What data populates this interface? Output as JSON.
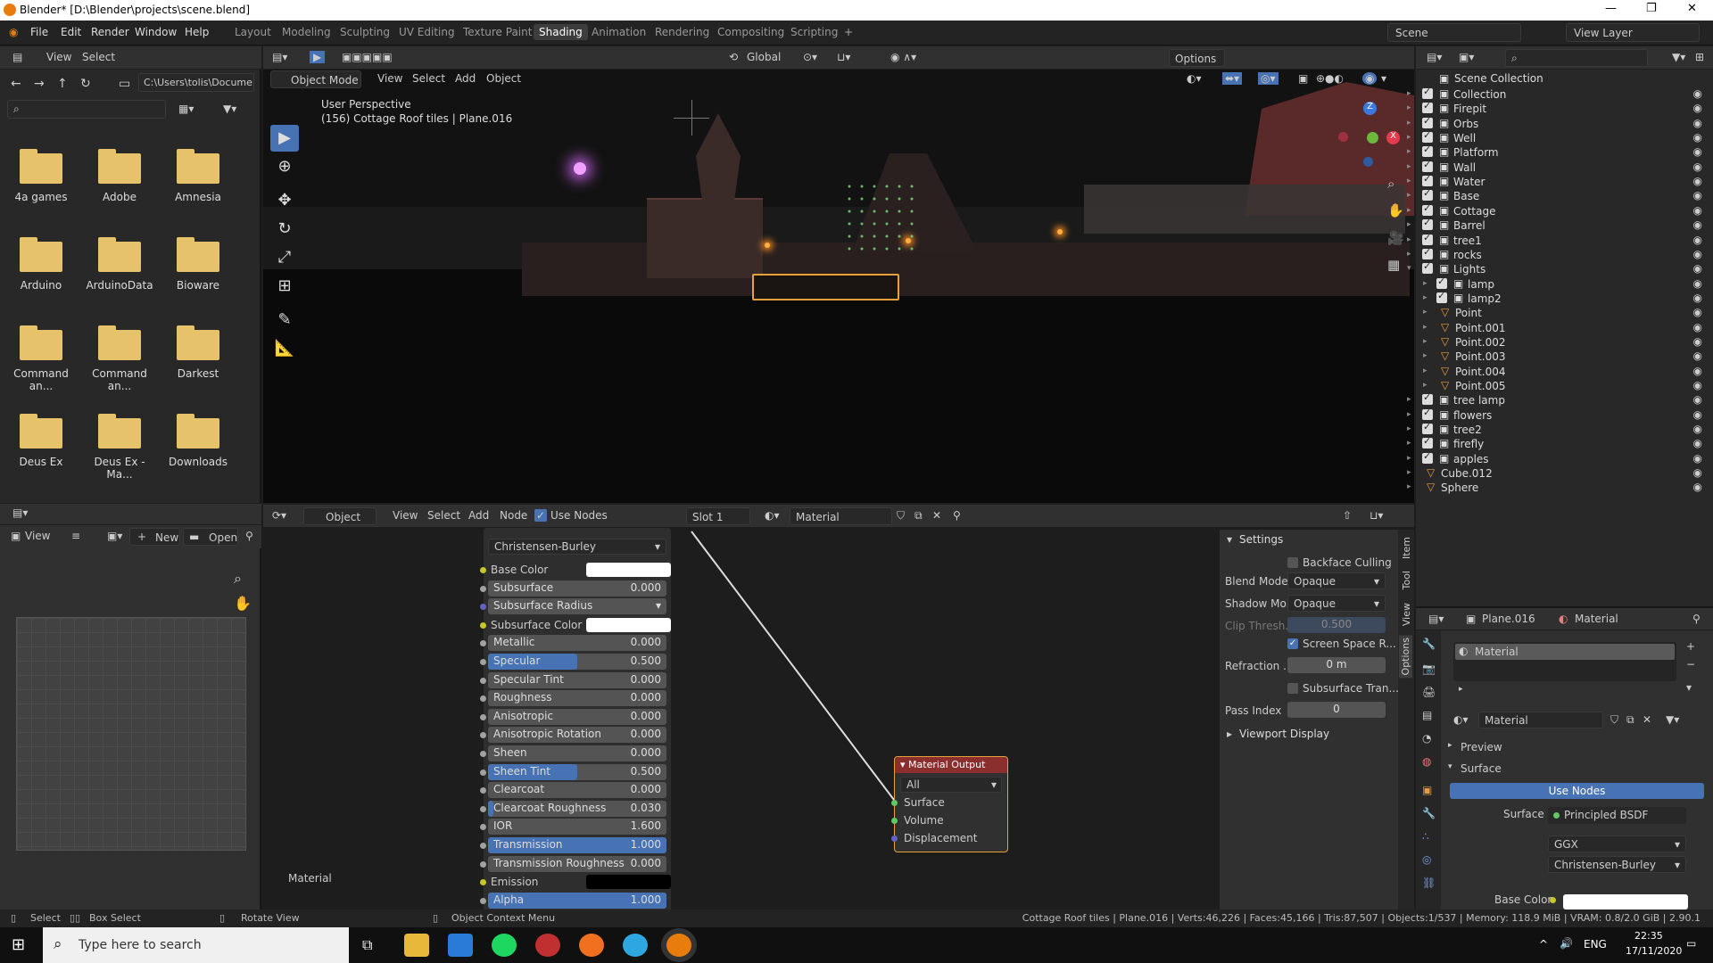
{
  "window": {
    "title": "Blender* [D:\\Blender\\projects\\scene.blend]",
    "min": "—",
    "max": "❐",
    "close": "✕"
  },
  "menu": [
    "File",
    "Edit",
    "Render",
    "Window",
    "Help"
  ],
  "workspaces": [
    "Layout",
    "Modeling",
    "Sculpting",
    "UV Editing",
    "Texture Paint",
    "Shading",
    "Animation",
    "Rendering",
    "Compositing",
    "Scripting"
  ],
  "active_workspace": "Shading",
  "scene": {
    "label": "Scene",
    "view_layer": "View Layer"
  },
  "file_browser": {
    "menus": [
      "View",
      "Select"
    ],
    "path": "C:\\Users\\tolis\\Docume...",
    "folders": [
      "4a games",
      "Adobe",
      "Amnesia",
      "Arduino",
      "ArduinoData",
      "Bioware",
      "Command an...",
      "Command an...",
      "Darkest",
      "Deus Ex",
      "Deus Ex - Ma...",
      "Downloads"
    ]
  },
  "image_editor": {
    "view": "View",
    "new": "New",
    "open": "Open"
  },
  "viewport": {
    "mode": "Object Mode",
    "menus": [
      "View",
      "Select",
      "Add",
      "Object"
    ],
    "transform": "Global",
    "options": "Options",
    "info1": "User Perspective",
    "info2": "(156) Cottage Roof tiles | Plane.016",
    "gizmo": {
      "z": "Z",
      "y": "Y",
      "x": "X"
    }
  },
  "node_editor": {
    "mode": "Object",
    "menus": [
      "View",
      "Select",
      "Add",
      "Node"
    ],
    "use_nodes": "Use Nodes",
    "slot": "Slot 1",
    "material": "Material",
    "label_bottom": "Material",
    "bsdf": {
      "distribution": "Christensen-Burley",
      "rows": [
        {
          "label": "Base Color",
          "type": "color",
          "color": "#ffffff",
          "socket": "#c7c729"
        },
        {
          "label": "Subsurface",
          "value": "0.000",
          "socket": "#a1a1a1"
        },
        {
          "label": "Subsurface Radius",
          "type": "select",
          "socket": "#6363c7"
        },
        {
          "label": "Subsurface Color",
          "type": "color",
          "color": "#ffffff",
          "socket": "#c7c729"
        },
        {
          "label": "Metallic",
          "value": "0.000",
          "socket": "#a1a1a1"
        },
        {
          "label": "Specular",
          "value": "0.500",
          "fill": 0.5,
          "socket": "#a1a1a1"
        },
        {
          "label": "Specular Tint",
          "value": "0.000",
          "socket": "#a1a1a1"
        },
        {
          "label": "Roughness",
          "value": "0.000",
          "socket": "#a1a1a1"
        },
        {
          "label": "Anisotropic",
          "value": "0.000",
          "socket": "#a1a1a1"
        },
        {
          "label": "Anisotropic Rotation",
          "value": "0.000",
          "socket": "#a1a1a1"
        },
        {
          "label": "Sheen",
          "value": "0.000",
          "socket": "#a1a1a1"
        },
        {
          "label": "Sheen Tint",
          "value": "0.500",
          "fill": 0.5,
          "socket": "#a1a1a1"
        },
        {
          "label": "Clearcoat",
          "value": "0.000",
          "socket": "#a1a1a1"
        },
        {
          "label": "Clearcoat Roughness",
          "value": "0.030",
          "fill": 0.03,
          "socket": "#a1a1a1"
        },
        {
          "label": "IOR",
          "value": "1.600",
          "socket": "#a1a1a1"
        },
        {
          "label": "Transmission",
          "value": "1.000",
          "fill": 1,
          "socket": "#a1a1a1"
        },
        {
          "label": "Transmission Roughness",
          "value": "0.000",
          "socket": "#a1a1a1"
        },
        {
          "label": "Emission",
          "type": "color",
          "color": "#000000",
          "socket": "#c7c729"
        },
        {
          "label": "Alpha",
          "value": "1.000",
          "fill": 1,
          "socket": "#a1a1a1"
        }
      ]
    },
    "output": {
      "title": "Material Output",
      "target": "All",
      "sockets": [
        "Surface",
        "Volume",
        "Displacement"
      ]
    }
  },
  "settings": {
    "title": "Settings",
    "backface": "Backface Culling",
    "blend_label": "Blend Mode",
    "blend": "Opaque",
    "shadow_label": "Shadow Mo...",
    "shadow": "Opaque",
    "clip_label": "Clip Thresh...",
    "clip": "0.500",
    "ssr": "Screen Space R...",
    "refraction_label": "Refraction ...",
    "refraction": "0 m",
    "sss": "Subsurface Tran...",
    "pass_label": "Pass Index",
    "pass": "0",
    "viewport_display": "Viewport Display",
    "tabs": [
      "Item",
      "Tool",
      "View",
      "Options"
    ]
  },
  "outliner": {
    "root": "Scene Collection",
    "items": [
      {
        "name": "Collection",
        "ind": 0,
        "col": true
      },
      {
        "name": "Firepit",
        "ind": 0,
        "col": true
      },
      {
        "name": "Orbs",
        "ind": 0,
        "col": true
      },
      {
        "name": "Well",
        "ind": 0,
        "col": true
      },
      {
        "name": "Platform",
        "ind": 0,
        "col": true
      },
      {
        "name": "Wall",
        "ind": 0,
        "col": true
      },
      {
        "name": "Water",
        "ind": 0,
        "col": true
      },
      {
        "name": "Base",
        "ind": 0,
        "col": true
      },
      {
        "name": "Cottage",
        "ind": 0,
        "col": true
      },
      {
        "name": "Barrel",
        "ind": 0,
        "col": true
      },
      {
        "name": "tree1",
        "ind": 0,
        "col": true
      },
      {
        "name": "rocks",
        "ind": 0,
        "col": true
      },
      {
        "name": "Lights",
        "ind": 0,
        "col": true
      },
      {
        "name": "lamp",
        "ind": 1,
        "col": true
      },
      {
        "name": "lamp2",
        "ind": 1,
        "col": true
      },
      {
        "name": "Point",
        "ind": 1,
        "col": false
      },
      {
        "name": "Point.001",
        "ind": 1,
        "col": false
      },
      {
        "name": "Point.002",
        "ind": 1,
        "col": false
      },
      {
        "name": "Point.003",
        "ind": 1,
        "col": false
      },
      {
        "name": "Point.004",
        "ind": 1,
        "col": false
      },
      {
        "name": "Point.005",
        "ind": 1,
        "col": false
      },
      {
        "name": "tree lamp",
        "ind": 0,
        "col": true
      },
      {
        "name": "flowers",
        "ind": 0,
        "col": true
      },
      {
        "name": "tree2",
        "ind": 0,
        "col": true
      },
      {
        "name": "firefly",
        "ind": 0,
        "col": true
      },
      {
        "name": "apples",
        "ind": 0,
        "col": true
      },
      {
        "name": "Cube.012",
        "ind": 0,
        "col": false
      },
      {
        "name": "Sphere",
        "ind": 0,
        "col": false
      }
    ]
  },
  "properties": {
    "object": "Plane.016",
    "material": "Material",
    "slot": "Material",
    "mat_name": "Material",
    "preview": "Preview",
    "surface": "Surface",
    "use_nodes": "Use Nodes",
    "surface_label": "Surface",
    "surface_value": "Principled BSDF",
    "dist": "GGX",
    "sss": "Christensen-Burley",
    "base_color": "Base Color"
  },
  "statusbar": {
    "select": "Select",
    "box": "Box Select",
    "rotate": "Rotate View",
    "context": "Object Context Menu",
    "stats": "Cottage Roof tiles | Plane.016 | Verts:46,226 | Faces:45,166 | Tris:87,507 | Objects:1/537 | Memory: 118.9 MiB | VRAM: 0.8/2.0 GiB | 2.90.1"
  },
  "taskbar": {
    "search": "Type here to search",
    "lang": "ENG",
    "time": "22:35",
    "date": "17/11/2020"
  }
}
